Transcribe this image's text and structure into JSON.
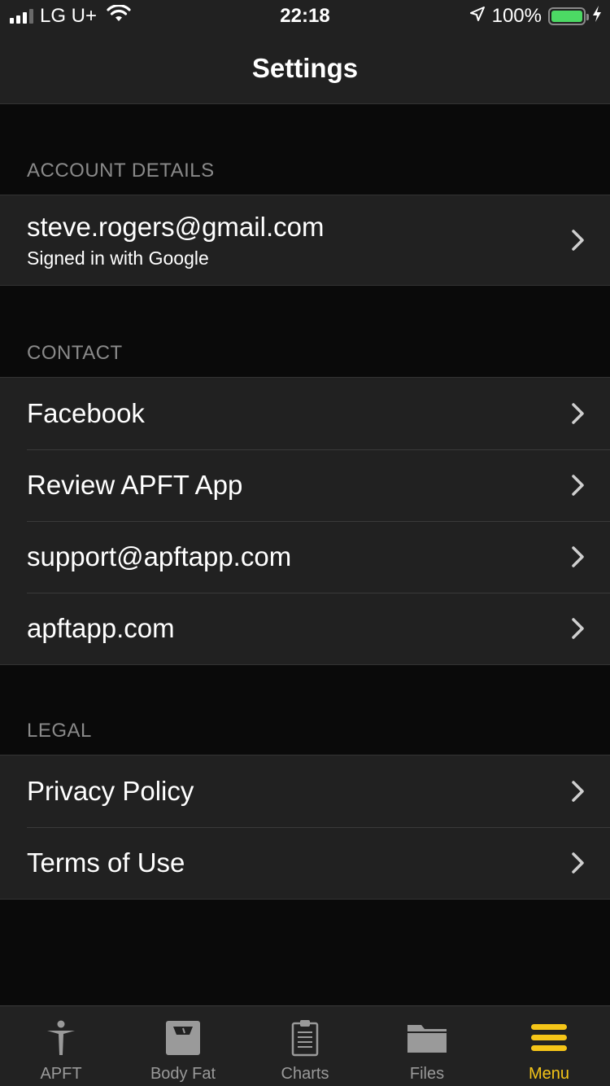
{
  "status_bar": {
    "carrier": "LG U+",
    "time": "22:18",
    "battery": "100%",
    "battery_level": 1.0,
    "signal_bars": 3
  },
  "nav": {
    "title": "Settings"
  },
  "sections": {
    "account": {
      "header": "ACCOUNT DETAILS",
      "email": "steve.rogers@gmail.com",
      "sub": "Signed in with Google"
    },
    "contact": {
      "header": "CONTACT",
      "items": [
        {
          "label": "Facebook"
        },
        {
          "label": "Review APFT App"
        },
        {
          "label": "support@apftapp.com"
        },
        {
          "label": "apftapp.com"
        }
      ]
    },
    "legal": {
      "header": "LEGAL",
      "items": [
        {
          "label": "Privacy Policy"
        },
        {
          "label": "Terms of Use"
        }
      ]
    }
  },
  "tabs": [
    {
      "label": "APFT",
      "icon": "person-icon",
      "active": false
    },
    {
      "label": "Body Fat",
      "icon": "scale-icon",
      "active": false
    },
    {
      "label": "Charts",
      "icon": "clipboard-icon",
      "active": false
    },
    {
      "label": "Files",
      "icon": "folder-icon",
      "active": false
    },
    {
      "label": "Menu",
      "icon": "menu-icon",
      "active": true
    }
  ],
  "colors": {
    "accent": "#f5c518",
    "battery": "#4cd964",
    "background": "#0a0a0a",
    "cell": "#212121",
    "section_header": "#8a8a8a"
  }
}
